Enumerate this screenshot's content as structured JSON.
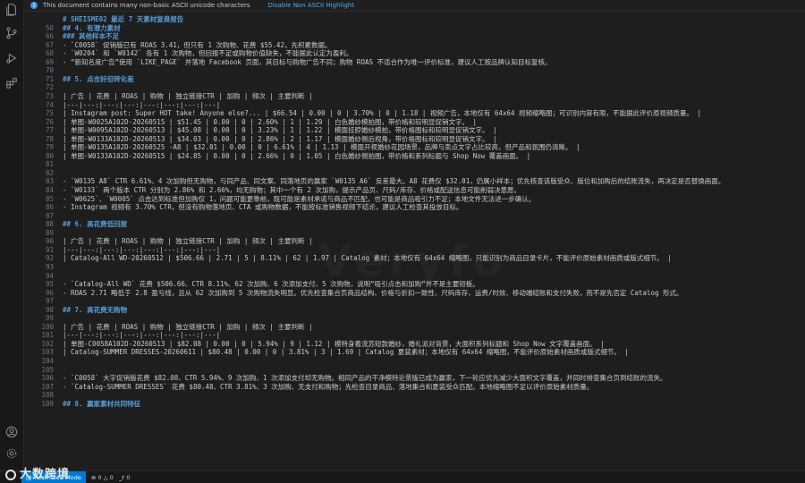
{
  "notice": {
    "text": "This document contains many non-basic ASCII unicode characters",
    "link": "Disable Non ASCII Highlight"
  },
  "editor": {
    "lines": [
      {
        "n": "",
        "t": "# SHEISME02 最近 7 天素材复盘报告",
        "h": true
      },
      {
        "n": "58",
        "t": "## 4. 有潜力素材",
        "h": true
      },
      {
        "n": "66",
        "t": "### 其他样本不足",
        "h": true
      },
      {
        "n": "67",
        "t": "- `C0058` 促销版已有 ROAS 3.41，但只有 1 次购物、花费 $55.42，先积累数据。",
        "h": false
      },
      {
        "n": "68",
        "t": "- `W0204` 和 `W0142` 各有 1 次购物，但回报不足或购物价值缺失，不能据此认定为盈利。",
        "h": false
      },
      {
        "n": "69",
        "t": "- “新知名度广告”使用 `LIKE_PAGE` 并落地 Facebook 页面，其目标与购物广告不同；购物 ROAS 不适合作为唯一评价标准，建议人工按品牌认知目标复核。",
        "h": false
      },
      {
        "n": "70",
        "t": "",
        "h": false
      },
      {
        "n": "71",
        "t": "## 5. 点击好但转化差",
        "h": true
      },
      {
        "n": "72",
        "t": "",
        "h": false
      },
      {
        "n": "73",
        "t": "| 广告 | 花费 | ROAS | 购物 | 独立链接CTR | 加购 | 频次 | 主要判断 |",
        "h": false
      },
      {
        "n": "74",
        "t": "|---|---:|---:|---:|---:|---:|---:|---|",
        "h": false
      },
      {
        "n": "75",
        "t": "| Instagram post: Super HOT take! Anyone else?... | $66.54 | 0.00 | 0 | 3.70% | 0 | 1.18 | 视频广告，本地仅有 64x64 视频缩略图；可识别内容有限，不能据此评价原视频质量。 |",
        "h": false
      },
      {
        "n": "76",
        "t": "| 单图-W0025A102D-20260515 | $51.45 | 0.00 | 0 | 2.60% | 1 | 1.29 | 白色婚纱模拍图，带价格和较明显促销文字。 |",
        "h": false
      },
      {
        "n": "77",
        "t": "| 单图-W0095A102D-20260513 | $45.08 | 0.00 | 0 | 3.23% | 1 | 1.22 | 模面挂脖婚纱模拍，带价格图标和较明显促销文字。 |",
        "h": false
      },
      {
        "n": "78",
        "t": "| 单图-W0133A102D-20260513 | $34.03 | 0.00 | 0 | 2.86% | 2 | 1.17 | 模面婚纱侧后视角，带价格图标和较明显促销文字。 |",
        "h": false
      },
      {
        "n": "79",
        "t": "| 单图-W0135A102D-20260525 -A8 | $32.01 | 0.00 | 0 | 6.61% | 4 | 1.13 | 模面开衩婚纱花园场景，品牌与卖点文字占比较高，但产品和氛围仍清晰。 |",
        "h": false
      },
      {
        "n": "80",
        "t": "| 单图-W0133A102D-20260515 | $24.85 | 0.00 | 0 | 2.66% | 0 | 1.05 | 白色婚纱侧拍图，带价格和系列标题与 Shop Now 覆盖画面。 |",
        "h": false
      },
      {
        "n": "81",
        "t": "",
        "h": false
      },
      {
        "n": "82",
        "t": "",
        "h": false
      },
      {
        "n": "83",
        "t": "- `W0135 A8` CTR 6.61%、4 次加购但无购物，与同产品、同文案、同落地页的赢家 `W0135 A6` 反差最大。A8 花费仅 $32.01，仍属小样本；优先核查该版受众、版位和加购后的结账流失，再决定是否替换画面。",
        "h": false
      },
      {
        "n": "84",
        "t": "- `W0133` 两个版本 CTR 分别为 2.86% 和 2.66%，均无购物；其中一个有 2 次加购，提示产品页、尺码/库存、价格或配送信息可能削弱决意愿。",
        "h": false
      },
      {
        "n": "85",
        "t": "- `W0625`、`W0005` 点击达到标准但加购仅 1，问题可能更靠前，既可能是素材承诺与商品不匹配，也可能是商品吸引力不足；本地文件无法进一步确认。",
        "h": false
      },
      {
        "n": "86",
        "t": "- Instagram 视频有 3.70% CTR，但没有购物落地页、CTA 或购物数据，不能按标准销售视频下结论，建议人工检查其投放目标。",
        "h": false
      },
      {
        "n": "87",
        "t": "",
        "h": false
      },
      {
        "n": "88",
        "t": "## 6. 高花费低回报",
        "h": true
      },
      {
        "n": "89",
        "t": "",
        "h": false
      },
      {
        "n": "90",
        "t": "| 广告 | 花费 | ROAS | 购物 | 独立链接CTR | 加购 | 频次 | 主要判断 |",
        "h": false
      },
      {
        "n": "91",
        "t": "|---|---:|---:|---:|---:|---:|---:|---|",
        "h": false
      },
      {
        "n": "92",
        "t": "| Catalog-All WD-20260512 | $506.66 | 2.71 | 5 | 8.11% | 62 | 1.97 | Catalog 素材；本地仅有 64x64 缩略图，只能识别为商品目录卡片，不能评价原始素材画质或版式细节。 |",
        "h": false
      },
      {
        "n": "93",
        "t": "",
        "h": false
      },
      {
        "n": "94",
        "t": "",
        "h": false
      },
      {
        "n": "95",
        "t": "- `Catalog-All WD` 花费 $506.66、CTR 8.11%、62 次加购、6 次添加支付、5 次购物，说明“吸引点击和加购”并不是主要短板。",
        "h": false
      },
      {
        "n": "96",
        "t": "- ROAS 2.71 略低于 2.8 盈亏线，且从 62 次加购到 5 次购物流失明显。优先检查集合页商品结构、价格与折扣一致性、尺码库存、运费/时效、移动端结账和支付失败，而不是先否定 Catalog 形式。",
        "h": false
      },
      {
        "n": "97",
        "t": "",
        "h": false
      },
      {
        "n": "98",
        "t": "## 7. 高花费无购物",
        "h": true
      },
      {
        "n": "99",
        "t": "",
        "h": false
      },
      {
        "n": "100",
        "t": "| 广告 | 花费 | ROAS | 购物 | 独立链接CTR | 加购 | 频次 | 主要判断 |",
        "h": false
      },
      {
        "n": "101",
        "t": "|---|---:|---:|---:|---:|---:|---:|---|",
        "h": false
      },
      {
        "n": "102",
        "t": "| 单图-C0058A102D-20260513 | $82.08 | 0.00 | 0 | 5.94% | 9 | 1.12 | 模特身着流苏短款婚纱，婚礼派对背景，大面积系列标题和 Shop Now 文字覆盖画面。 |",
        "h": false
      },
      {
        "n": "103",
        "t": "| Catalog-SUMMER DRESSES-20260611 | $80.48 | 0.00 | 0 | 3.81% | 3 | 1.69 | Catalog 夏装素材；本地仅有 64x64 缩略图，不能评价原始素材画质或版式细节。 |",
        "h": false
      },
      {
        "n": "104",
        "t": "",
        "h": false
      },
      {
        "n": "105",
        "t": "",
        "h": false
      },
      {
        "n": "106",
        "t": "- `C0058` 大字促销版花费 $82.08、CTR 5.94%、9 次加购、1 次添加支付却无购物。相同产品的干净模特近景版已成为赢家，下一轮应优先减少大面积文字覆盖，并同时排查集合页到结账的流失。",
        "h": false
      },
      {
        "n": "107",
        "t": "- `Catalog-SUMMER DRESSES` 花费 $80.48、CTR 3.81%、3 次加购、无支付和购物；先检查目录商品、落地集合和夏装受众匹配。本地缩略图不足以评价原始素材质量。",
        "h": false
      },
      {
        "n": "108",
        "t": "",
        "h": false
      },
      {
        "n": "109",
        "t": "## 8. 赢家素材共同特征",
        "h": true
      }
    ]
  },
  "watermark": "Veryfo",
  "statusbar": {
    "restricted": "Restricted Mode",
    "errors": "0",
    "warnings": "0",
    "ports": "0"
  },
  "logo": {
    "text": "大数跨境"
  }
}
